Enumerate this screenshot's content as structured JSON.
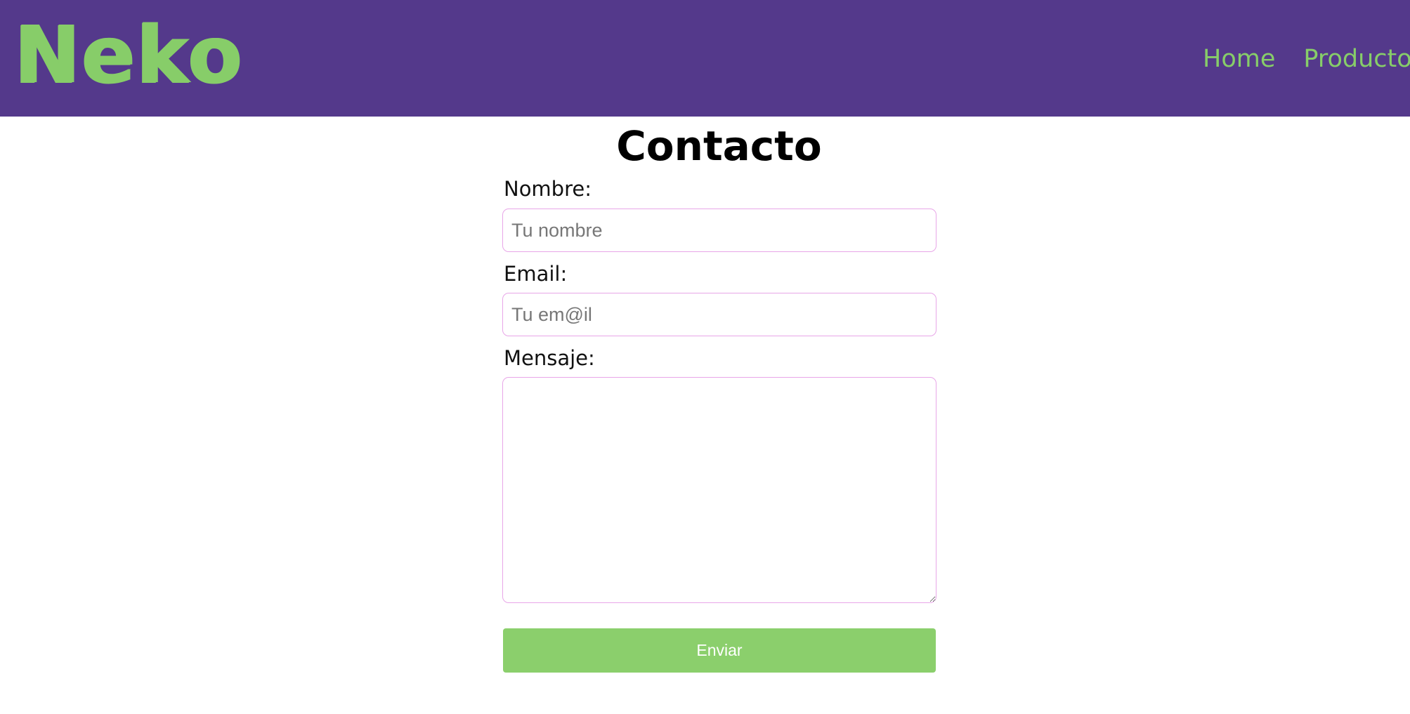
{
  "header": {
    "logo_text": "Neko",
    "nav": [
      {
        "label": "Home"
      },
      {
        "label": "Producto"
      }
    ]
  },
  "main": {
    "title": "Contacto",
    "form": {
      "name_label": "Nombre:",
      "name_placeholder": "Tu nombre",
      "name_value": "",
      "email_label": "Email:",
      "email_placeholder": "Tu em@il",
      "email_value": "",
      "message_label": "Mensaje:",
      "message_value": "",
      "submit_label": "Enviar"
    }
  },
  "colors": {
    "header_background": "#54398b",
    "accent_green": "#87cd69",
    "field_border": "#e8a6e8"
  }
}
